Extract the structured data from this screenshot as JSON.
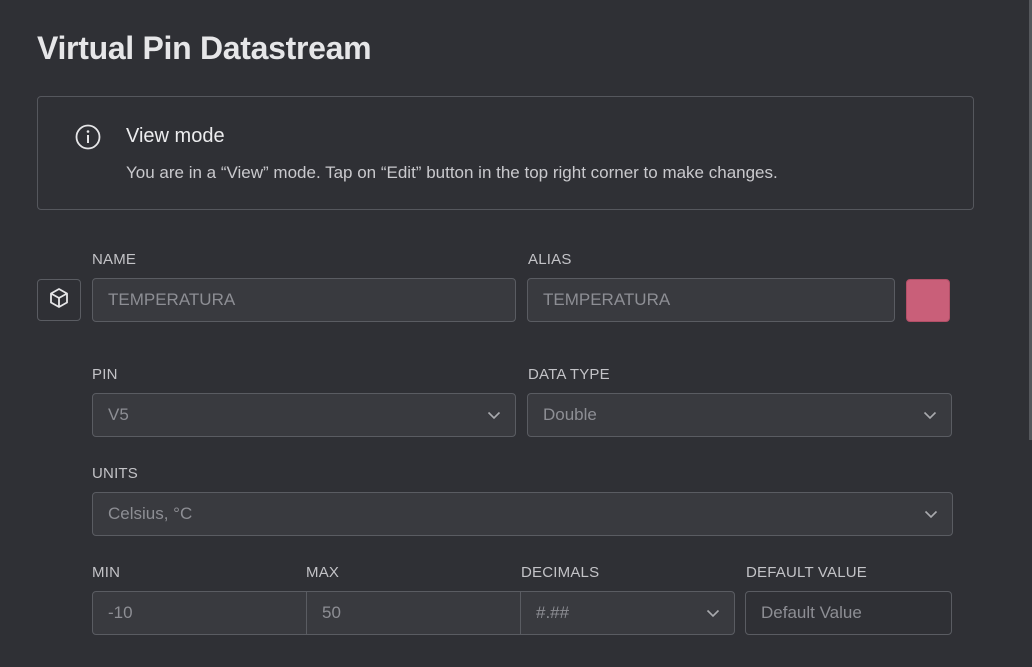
{
  "page": {
    "title": "Virtual Pin Datastream"
  },
  "info": {
    "icon": "info-circle-icon",
    "title": "View mode",
    "text": "You are in a “View” mode. Tap on “Edit” button in the top right corner to make changes."
  },
  "form": {
    "icon": "cube-icon",
    "color": "#c95f79",
    "name": {
      "label": "NAME",
      "value": "TEMPERATURA"
    },
    "alias": {
      "label": "ALIAS",
      "value": "TEMPERATURA"
    },
    "pin": {
      "label": "PIN",
      "value": "V5"
    },
    "data_type": {
      "label": "DATA TYPE",
      "value": "Double"
    },
    "units": {
      "label": "UNITS",
      "value": "Celsius, °C"
    },
    "min": {
      "label": "MIN",
      "value": "-10"
    },
    "max": {
      "label": "MAX",
      "value": "50"
    },
    "decimals": {
      "label": "DECIMALS",
      "value": "#.##"
    },
    "default_value": {
      "label": "DEFAULT VALUE",
      "placeholder": "Default Value"
    }
  }
}
